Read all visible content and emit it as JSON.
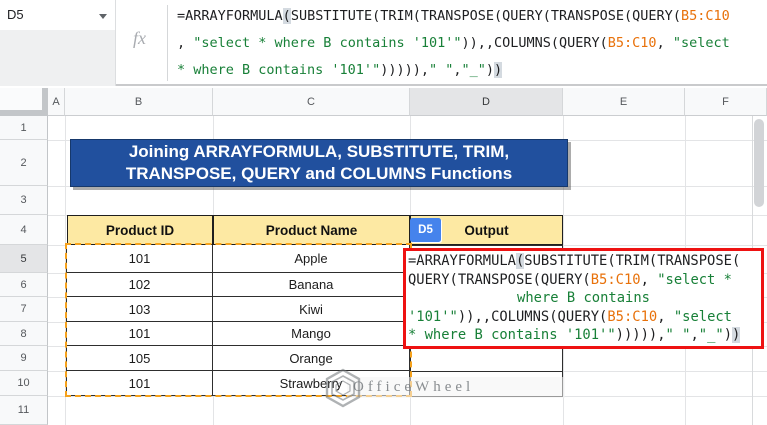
{
  "toolbar": {
    "name_box_value": "D5",
    "fx_label": "fx",
    "formula_lines": [
      [
        {
          "t": "=ARRAYFORMULA",
          "c": "d"
        },
        {
          "t": "(",
          "c": "hl"
        },
        {
          "t": "SUBSTITUTE(TRIM(TRANSPOSE(QUERY(TRANSPOSE(QUERY(",
          "c": "d"
        },
        {
          "t": "B5:C10",
          "c": "o"
        }
      ],
      [
        {
          "t": ", ",
          "c": "d"
        },
        {
          "t": "\"select * where B contains '101'\"",
          "c": "g"
        },
        {
          "t": ")),,COLUMNS(QUERY(",
          "c": "d"
        },
        {
          "t": "B5:C10",
          "c": "o"
        },
        {
          "t": ", ",
          "c": "d"
        },
        {
          "t": "\"select",
          "c": "g"
        }
      ],
      [
        {
          "t": "* where B contains '101'\"",
          "c": "g"
        },
        {
          "t": ")))))",
          "c": "d"
        },
        {
          "t": ",",
          "c": "d"
        },
        {
          "t": "\" \"",
          "c": "g"
        },
        {
          "t": ",",
          "c": "d"
        },
        {
          "t": "\"_\"",
          "c": "g"
        },
        {
          "t": ")",
          "c": "d"
        },
        {
          "t": ")",
          "c": "hl"
        }
      ]
    ]
  },
  "grid": {
    "column_headers": [
      "A",
      "B",
      "C",
      "D",
      "E",
      "F"
    ],
    "row_headers": [
      "1",
      "2",
      "3",
      "4",
      "5",
      "6",
      "7",
      "8",
      "9",
      "10",
      "11"
    ],
    "selected_column": "D",
    "selected_row": "5"
  },
  "banner": {
    "line1": "Joining ARRAYFORMULA, SUBSTITUTE, TRIM,",
    "line2": "TRANSPOSE, QUERY and COLUMNS Functions"
  },
  "table": {
    "headers": [
      "Product ID",
      "Product Name"
    ],
    "output_header": "Output",
    "output_cell_badge": "D5",
    "rows": [
      [
        "101",
        "Apple"
      ],
      [
        "102",
        "Banana"
      ],
      [
        "103",
        "Kiwi"
      ],
      [
        "101",
        "Mango"
      ],
      [
        "105",
        "Orange"
      ],
      [
        "101",
        "Strawberry"
      ]
    ]
  },
  "output_cell": {
    "formula_lines": [
      [
        {
          "t": "=ARRAYFORMULA",
          "c": "d"
        },
        {
          "t": "(",
          "c": "hl"
        },
        {
          "t": "SUBSTITUTE(TRIM(TRANSPOSE(",
          "c": "d"
        }
      ],
      [
        {
          "t": "QUERY(TRANSPOSE(QUERY(",
          "c": "d"
        },
        {
          "t": "B5:C10",
          "c": "o"
        },
        {
          "t": ", ",
          "c": "d"
        },
        {
          "t": "\"select *",
          "c": "g"
        }
      ],
      [
        {
          "t": "where B contains",
          "c": "g"
        }
      ],
      [
        {
          "t": "'101'\"",
          "c": "g"
        },
        {
          "t": ")),,COLUMNS(QUERY(",
          "c": "d"
        },
        {
          "t": "B5:C10",
          "c": "o"
        },
        {
          "t": ", ",
          "c": "d"
        },
        {
          "t": "\"select",
          "c": "g"
        }
      ],
      [
        {
          "t": "* where B contains '101'\"",
          "c": "g"
        },
        {
          "t": ")))))",
          "c": "d"
        },
        {
          "t": ",",
          "c": "d"
        },
        {
          "t": "\" \"",
          "c": "g"
        },
        {
          "t": ",",
          "c": "d"
        },
        {
          "t": "\"_\"",
          "c": "g"
        },
        {
          "t": ")",
          "c": "d"
        },
        {
          "t": ")",
          "c": "hl"
        }
      ]
    ]
  },
  "watermark": {
    "text": "OfficeWheel"
  },
  "colors": {
    "banner_bg": "#21509e",
    "table_header_bg": "#fde9a3",
    "badge_bg": "#4583ec",
    "highlight_border": "#ee1212",
    "range_dash": "#f6a21c",
    "formula_string": "#188038",
    "formula_range": "#e8710a"
  }
}
